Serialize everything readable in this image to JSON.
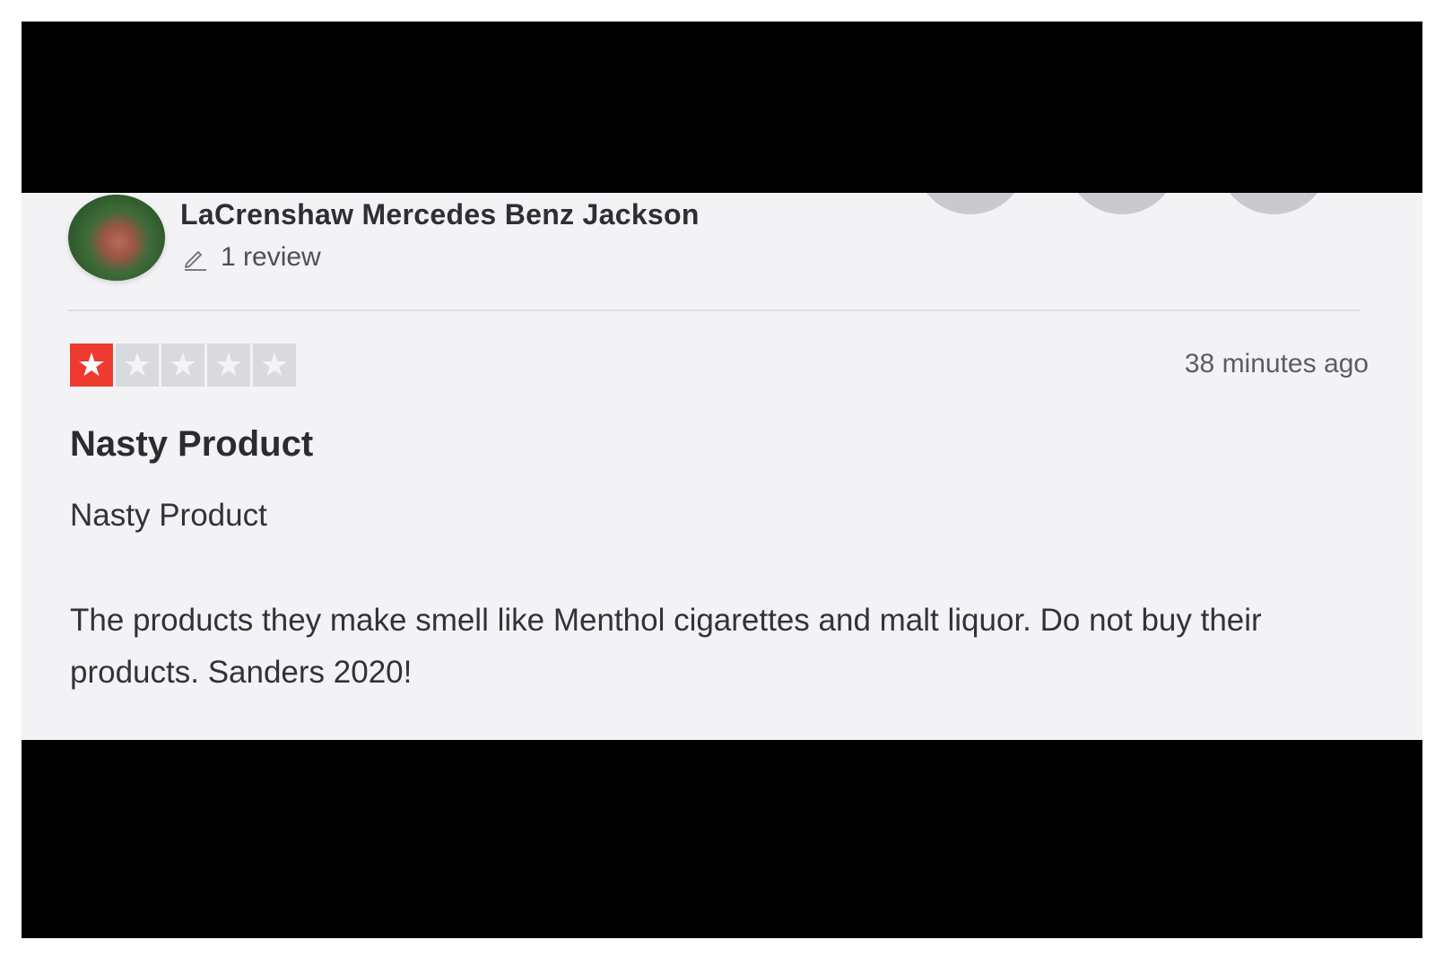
{
  "reviewer": {
    "name": "LaCrenshaw Mercedes Benz Jackson",
    "review_count": "1 review",
    "avatar_icon": "avatar-photo",
    "review_count_icon": "pencil-icon"
  },
  "review": {
    "rating": 1,
    "rating_max": 5,
    "timestamp": "38 minutes ago",
    "title": "Nasty Product",
    "subtitle": "Nasty Product",
    "body": "The products they make smell like Menthol cigarettes and malt liquor. Do not buy their products. Sanders 2020!"
  },
  "colors": {
    "star_filled": "#ee3a2f",
    "star_empty": "#d9d9e0",
    "card_background": "#f3f3f6",
    "frame_background": "#000000"
  }
}
